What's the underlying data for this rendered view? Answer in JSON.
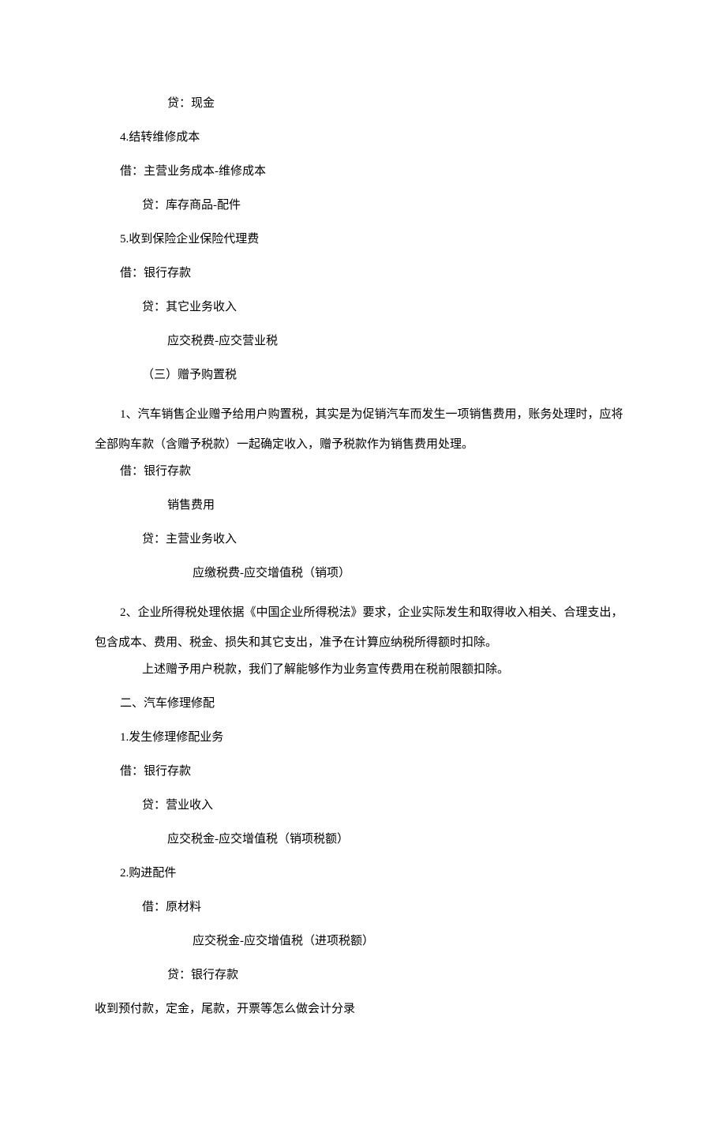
{
  "lines": {
    "l1": "贷：现金",
    "l2": "4.结转维修成本",
    "l3": "借：主营业务成本-维修成本",
    "l4": "贷：库存商品-配件",
    "l5": "5.收到保险企业保险代理费",
    "l6": "借：银行存款",
    "l7": "贷：其它业务收入",
    "l8": "应交税费-应交营业税",
    "l9": "（三）赠予购置税",
    "l10": "1、汽车销售企业赠予给用户购置税，其实是为促销汽车而发生一项销售费用，账务处理时，应将全部购车款（含赠予税款）一起确定收入，赠予税款作为销售费用处理。",
    "l11": "借：银行存款",
    "l12": "销售费用",
    "l13": "贷：主营业务收入",
    "l14": "应缴税费-应交增值税（销项）",
    "l15": "2、企业所得税处理依据《中国企业所得税法》要求，企业实际发生和取得收入相关、合理支出，包含成本、费用、税金、损失和其它支出，准予在计算应纳税所得额时扣除。",
    "l16": "上述赠予用户税款，我们了解能够作为业务宣传费用在税前限额扣除。",
    "l17": "二、汽车修理修配",
    "l18": "1.发生修理修配业务",
    "l19": "借：银行存款",
    "l20": "贷：营业收入",
    "l21": "应交税金-应交增值税（销项税额）",
    "l22": "2.购进配件",
    "l23": "借：原材料",
    "l24": "应交税金-应交增值税（进项税额）",
    "l25": "贷：银行存款",
    "l26": "收到预付款，定金，尾款，开票等怎么做会计分录"
  }
}
